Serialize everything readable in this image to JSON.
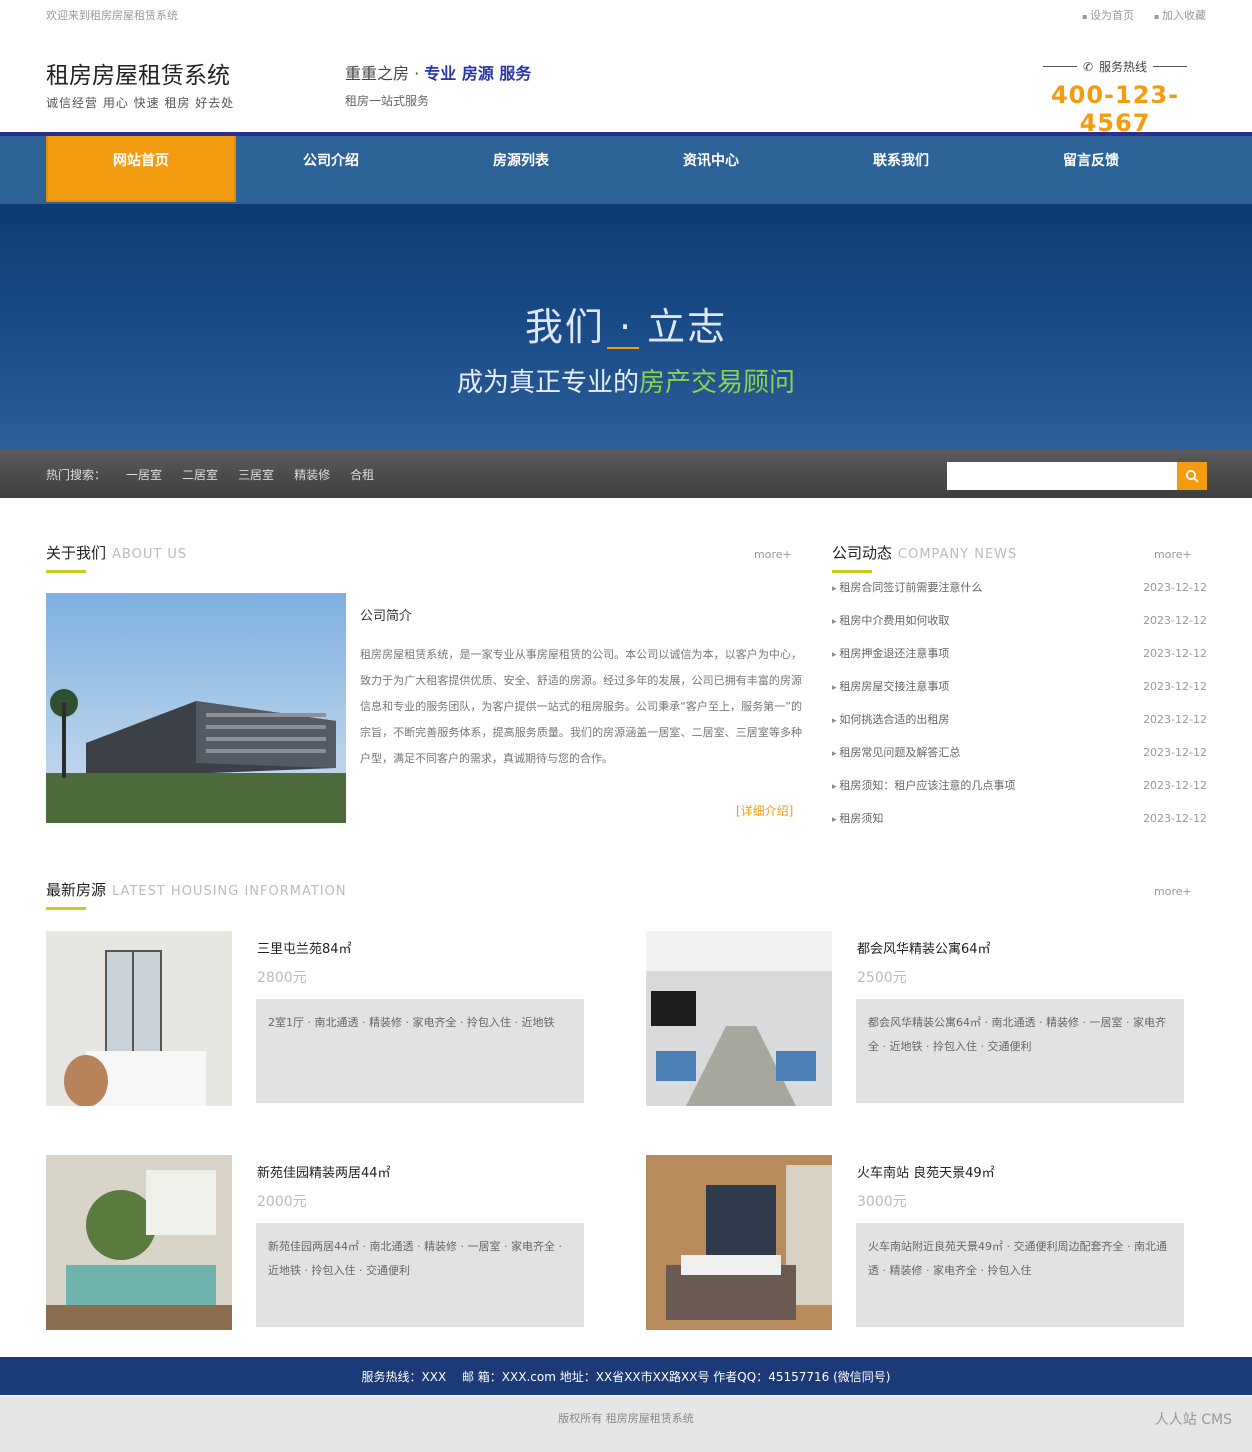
{
  "topbar": {
    "welcome": "欢迎来到租房房屋租赁系统",
    "links": [
      "设为首页",
      "加入收藏"
    ]
  },
  "header": {
    "site_name": "租房房屋租赁系统",
    "tagline": "诚信经营 用心 快速 租房 好去处",
    "slogan_prefix": "重重之房",
    "slogan_highlight": "专业 房源 服务",
    "slogan_sub": "租房一站式服务",
    "hotline_label": "服务热线",
    "hotline_number": "400-123-4567"
  },
  "nav": {
    "items": [
      "网站首页",
      "公司介绍",
      "房源列表",
      "资讯中心",
      "联系我们",
      "留言反馈"
    ],
    "active": 0
  },
  "banner": {
    "line1": "我们 · 立志",
    "line2_prefix": "成为真正专业的",
    "line2_highlight": "房产交易顾问"
  },
  "search_strip": {
    "hot_label": "热门搜索：",
    "hot": [
      "一居室",
      "二居室",
      "三居室",
      "精装修",
      "合租"
    ],
    "placeholder": "",
    "button_icon": "search-icon"
  },
  "about": {
    "heading": "关于我们",
    "heading_en": "ABOUT US",
    "more": "more+",
    "title": "公司简介",
    "text": "租房房屋租赁系统，是一家专业从事房屋租赁的公司。本公司以诚信为本，以客户为中心，致力于为广大租客提供优质、安全、舒适的房源。经过多年的发展，公司已拥有丰富的房源信息和专业的服务团队，为客户提供一站式的租房服务。公司秉承“客户至上，服务第一”的宗旨，不断完善服务体系，提高服务质量。我们的房源涵盖一居室、二居室、三居室等多种户型，满足不同客户的需求，真诚期待与您的合作。",
    "detail_link": "[详细介绍]"
  },
  "news": {
    "heading": "公司动态",
    "heading_en": "COMPANY NEWS",
    "more": "more+",
    "items": [
      {
        "title": "租房合同签订前需要注意什么",
        "date": "2023-12-12"
      },
      {
        "title": "租房中介费用如何收取",
        "date": "2023-12-12"
      },
      {
        "title": "租房押金退还注意事项",
        "date": "2023-12-12"
      },
      {
        "title": "租房房屋交接注意事项",
        "date": "2023-12-12"
      },
      {
        "title": "如何挑选合适的出租房",
        "date": "2023-12-12"
      },
      {
        "title": "租房常见问题及解答汇总",
        "date": "2023-12-12"
      },
      {
        "title": "租房须知：租户应该注意的几点事项",
        "date": "2023-12-12"
      },
      {
        "title": "租房须知",
        "date": "2023-12-12"
      }
    ]
  },
  "houses": {
    "heading": "最新房源",
    "heading_en": "LATEST HOUSING INFORMATION",
    "more": "more+",
    "items": [
      {
        "title": "三里屯兰苑84㎡",
        "price": "2800元",
        "desc": "2室1厅 · 南北通透 · 精装修 · 家电齐全 · 拎包入住 · 近地铁"
      },
      {
        "title": "都会风华精装公寓64㎡",
        "price": "2500元",
        "desc": "都会风华精装公寓64㎡ · 南北通透 · 精装修 · 一居室 · 家电齐全 · 近地铁 · 拎包入住 · 交通便利"
      },
      {
        "title": "新苑佳园精装两居44㎡",
        "price": "2000元",
        "desc": "新苑佳园两居44㎡ · 南北通透 · 精装修 · 一居室 · 家电齐全 · 近地铁 · 拎包入住 · 交通便利"
      },
      {
        "title": "火车南站 良苑天景49㎡",
        "price": "3000元",
        "desc": "火车南站附近良苑天景49㎡ · 交通便利周边配套齐全 · 南北通透 · 精装修 · 家电齐全 · 拎包入住"
      }
    ]
  },
  "footer": {
    "contact": "服务热线：XXX　 邮 箱：XXX.com  地址：XX省XX市XX路XX号  作者QQ：45157716  (微信同号)",
    "copyright": "版权所有 租房房屋租赁系统",
    "brandmark": "人人站 CMS"
  }
}
